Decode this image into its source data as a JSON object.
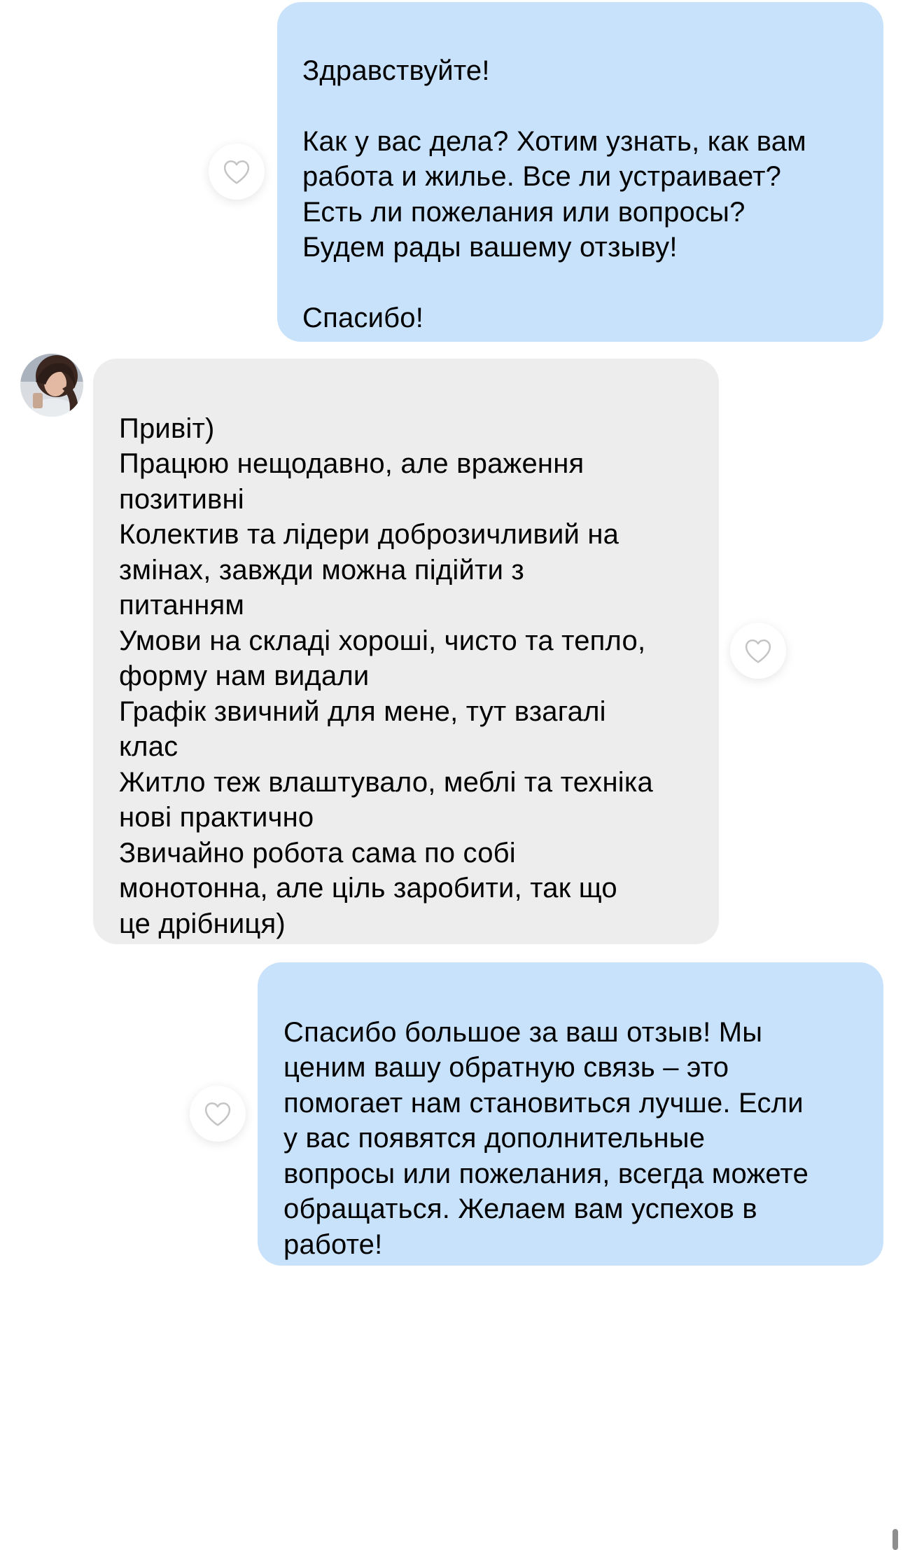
{
  "messages": [
    {
      "direction": "outgoing",
      "text": "Здравствуйте!\n\nКак у вас дела? Хотим узнать, как вам\nработа и жилье. Все ли устраивает?\nЕсть ли пожелания или вопросы?\nБудем рады вашему отзыву!\n\nСпасибо!"
    },
    {
      "direction": "incoming",
      "text": "Привіт)\nПрацюю  нещодавно, але враження\nпозитивні\nКолектив  та лідери доброзичливий на\nзмінах, завжди можна підійти з\nпитанням\nУмови на складі хороші, чисто та тепло,\nформу нам видали\nГрафік звичний для мене, тут взагалі\nклас\nЖитло теж влаштувало, меблі та техніка\nнові практично\nЗвичайно робота сама по собі\nмонотонна, але ціль заробити, так що\nце дрібниця)"
    },
    {
      "direction": "outgoing",
      "text": "Спасибо большое за ваш отзыв! Мы\nценим вашу обратную связь – это\nпомогает нам становиться лучше. Если\nу вас появятся дополнительные\nвопросы или пожелания, всегда можете\nобращаться. Желаем вам успехов в\nработе!"
    }
  ],
  "icons": {
    "like": "heart-outline-icon",
    "avatar": "user-avatar"
  },
  "colors": {
    "outgoing_bubble": "#c9e2fb",
    "incoming_bubble": "#ededed",
    "heart_stroke": "#c4c4c4"
  }
}
